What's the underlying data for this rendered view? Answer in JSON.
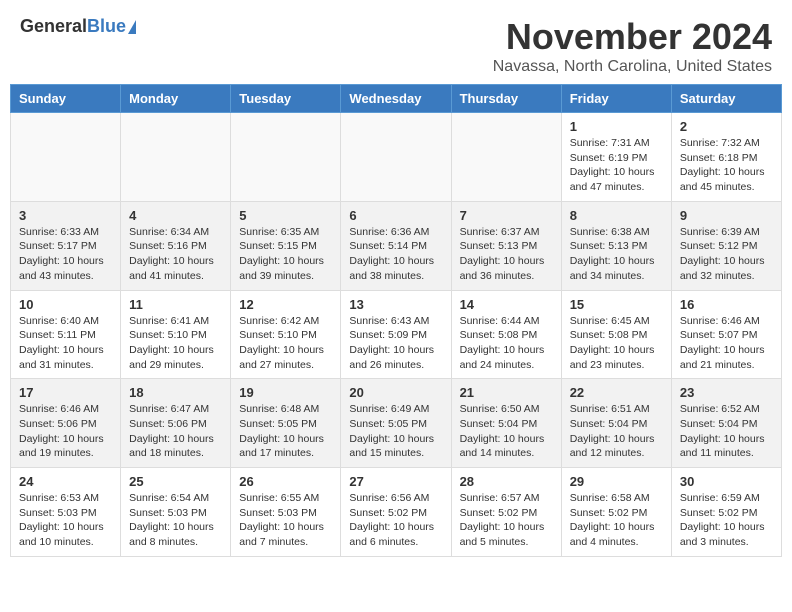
{
  "header": {
    "logo_general": "General",
    "logo_blue": "Blue",
    "month_title": "November 2024",
    "location": "Navassa, North Carolina, United States"
  },
  "calendar": {
    "days_of_week": [
      "Sunday",
      "Monday",
      "Tuesday",
      "Wednesday",
      "Thursday",
      "Friday",
      "Saturday"
    ],
    "weeks": [
      [
        {
          "day": "",
          "info": "",
          "empty": true
        },
        {
          "day": "",
          "info": "",
          "empty": true
        },
        {
          "day": "",
          "info": "",
          "empty": true
        },
        {
          "day": "",
          "info": "",
          "empty": true
        },
        {
          "day": "",
          "info": "",
          "empty": true
        },
        {
          "day": "1",
          "info": "Sunrise: 7:31 AM\nSunset: 6:19 PM\nDaylight: 10 hours\nand 47 minutes."
        },
        {
          "day": "2",
          "info": "Sunrise: 7:32 AM\nSunset: 6:18 PM\nDaylight: 10 hours\nand 45 minutes."
        }
      ],
      [
        {
          "day": "3",
          "info": "Sunrise: 6:33 AM\nSunset: 5:17 PM\nDaylight: 10 hours\nand 43 minutes."
        },
        {
          "day": "4",
          "info": "Sunrise: 6:34 AM\nSunset: 5:16 PM\nDaylight: 10 hours\nand 41 minutes."
        },
        {
          "day": "5",
          "info": "Sunrise: 6:35 AM\nSunset: 5:15 PM\nDaylight: 10 hours\nand 39 minutes."
        },
        {
          "day": "6",
          "info": "Sunrise: 6:36 AM\nSunset: 5:14 PM\nDaylight: 10 hours\nand 38 minutes."
        },
        {
          "day": "7",
          "info": "Sunrise: 6:37 AM\nSunset: 5:13 PM\nDaylight: 10 hours\nand 36 minutes."
        },
        {
          "day": "8",
          "info": "Sunrise: 6:38 AM\nSunset: 5:13 PM\nDaylight: 10 hours\nand 34 minutes."
        },
        {
          "day": "9",
          "info": "Sunrise: 6:39 AM\nSunset: 5:12 PM\nDaylight: 10 hours\nand 32 minutes."
        }
      ],
      [
        {
          "day": "10",
          "info": "Sunrise: 6:40 AM\nSunset: 5:11 PM\nDaylight: 10 hours\nand 31 minutes."
        },
        {
          "day": "11",
          "info": "Sunrise: 6:41 AM\nSunset: 5:10 PM\nDaylight: 10 hours\nand 29 minutes."
        },
        {
          "day": "12",
          "info": "Sunrise: 6:42 AM\nSunset: 5:10 PM\nDaylight: 10 hours\nand 27 minutes."
        },
        {
          "day": "13",
          "info": "Sunrise: 6:43 AM\nSunset: 5:09 PM\nDaylight: 10 hours\nand 26 minutes."
        },
        {
          "day": "14",
          "info": "Sunrise: 6:44 AM\nSunset: 5:08 PM\nDaylight: 10 hours\nand 24 minutes."
        },
        {
          "day": "15",
          "info": "Sunrise: 6:45 AM\nSunset: 5:08 PM\nDaylight: 10 hours\nand 23 minutes."
        },
        {
          "day": "16",
          "info": "Sunrise: 6:46 AM\nSunset: 5:07 PM\nDaylight: 10 hours\nand 21 minutes."
        }
      ],
      [
        {
          "day": "17",
          "info": "Sunrise: 6:46 AM\nSunset: 5:06 PM\nDaylight: 10 hours\nand 19 minutes."
        },
        {
          "day": "18",
          "info": "Sunrise: 6:47 AM\nSunset: 5:06 PM\nDaylight: 10 hours\nand 18 minutes."
        },
        {
          "day": "19",
          "info": "Sunrise: 6:48 AM\nSunset: 5:05 PM\nDaylight: 10 hours\nand 17 minutes."
        },
        {
          "day": "20",
          "info": "Sunrise: 6:49 AM\nSunset: 5:05 PM\nDaylight: 10 hours\nand 15 minutes."
        },
        {
          "day": "21",
          "info": "Sunrise: 6:50 AM\nSunset: 5:04 PM\nDaylight: 10 hours\nand 14 minutes."
        },
        {
          "day": "22",
          "info": "Sunrise: 6:51 AM\nSunset: 5:04 PM\nDaylight: 10 hours\nand 12 minutes."
        },
        {
          "day": "23",
          "info": "Sunrise: 6:52 AM\nSunset: 5:04 PM\nDaylight: 10 hours\nand 11 minutes."
        }
      ],
      [
        {
          "day": "24",
          "info": "Sunrise: 6:53 AM\nSunset: 5:03 PM\nDaylight: 10 hours\nand 10 minutes."
        },
        {
          "day": "25",
          "info": "Sunrise: 6:54 AM\nSunset: 5:03 PM\nDaylight: 10 hours\nand 8 minutes."
        },
        {
          "day": "26",
          "info": "Sunrise: 6:55 AM\nSunset: 5:03 PM\nDaylight: 10 hours\nand 7 minutes."
        },
        {
          "day": "27",
          "info": "Sunrise: 6:56 AM\nSunset: 5:02 PM\nDaylight: 10 hours\nand 6 minutes."
        },
        {
          "day": "28",
          "info": "Sunrise: 6:57 AM\nSunset: 5:02 PM\nDaylight: 10 hours\nand 5 minutes."
        },
        {
          "day": "29",
          "info": "Sunrise: 6:58 AM\nSunset: 5:02 PM\nDaylight: 10 hours\nand 4 minutes."
        },
        {
          "day": "30",
          "info": "Sunrise: 6:59 AM\nSunset: 5:02 PM\nDaylight: 10 hours\nand 3 minutes."
        }
      ]
    ]
  }
}
